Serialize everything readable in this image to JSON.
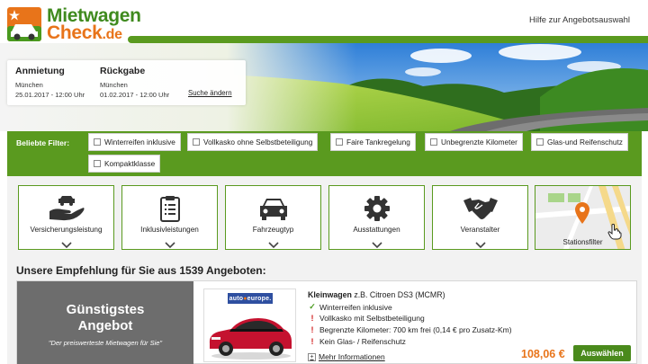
{
  "header": {
    "logo_line1": "Mietwagen",
    "logo_line2": "Check",
    "logo_tld": ".de",
    "help_link": "Hilfe zur Angebotsauswahl"
  },
  "booking": {
    "pickup": {
      "heading": "Anmietung",
      "location": "München",
      "datetime": "25.01.2017 - 12:00 Uhr"
    },
    "return": {
      "heading": "Rückgabe",
      "location": "München",
      "datetime": "01.02.2017 - 12:00 Uhr"
    },
    "change_link": "Suche ändern"
  },
  "filters": {
    "label": "Beliebte Filter:",
    "items": [
      "Winterreifen inklusive",
      "Vollkasko ohne Selbstbeteiligung",
      "Faire Tankregelung",
      "Unbegrenzte Kilometer",
      "Glas-und Reifenschutz",
      "Kompaktklasse"
    ]
  },
  "categories": {
    "items": [
      {
        "label": "Versicherungsleistung",
        "icon": "insurance-hand-car-icon"
      },
      {
        "label": "Inklusivleistungen",
        "icon": "clipboard-icon"
      },
      {
        "label": "Fahrzeugtyp",
        "icon": "car-front-icon"
      },
      {
        "label": "Ausstattungen",
        "icon": "gear-icon"
      },
      {
        "label": "Veranstalter",
        "icon": "handshake-icon"
      },
      {
        "label": "Stationsfilter",
        "icon": "map-pin-icon"
      }
    ]
  },
  "recommendation": {
    "title": "Unsere Empfehlung für Sie aus 1539 Angeboten:",
    "badge_title_line1": "Günstigstes",
    "badge_title_line2": "Angebot",
    "badge_subtitle": "\"Der preiswerteste Mietwagen für Sie\"",
    "vendor": {
      "prefix": "auto",
      "suffix": "europe."
    },
    "car_class": "Kleinwagen",
    "car_model": " z.B. Citroen DS3 (MCMR)",
    "features": [
      {
        "text": "Winterreifen inklusive",
        "status": "ok"
      },
      {
        "text": "Vollkasko mit Selbstbeteiligung",
        "status": "warn"
      },
      {
        "text": "Begrenzte Kilometer: 700 km frei (0,14 € pro Zusatz-Km)",
        "status": "warn"
      },
      {
        "text": "Kein Glas- / Reifenschutz",
        "status": "warn"
      }
    ],
    "more_info": "Mehr Informationen",
    "price": "108,06 €",
    "select_button": "Auswählen"
  },
  "colors": {
    "green": "#5a9a1f",
    "orange": "#e8741a",
    "grey": "#6d6d6d",
    "red": "#d11d1d"
  }
}
